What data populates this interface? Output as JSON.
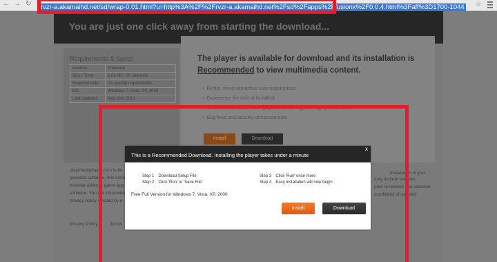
{
  "browser": {
    "back_icon": "back-arrow-icon",
    "forward_icon": "forward-arrow-icon",
    "reload_icon": "reload-icon",
    "url": "rvzr-a.akamaihd.net/sd/wrap-0.01.html?u=http%3A%2F%2Frvzr-a.akamaihd.net%2Fsd%2Fapps%2Ffusionx%2F0.0.4.html%3Faff%3D1700-1044",
    "star_icon": "star-icon",
    "menu_icon": "hamburger-menu-icon"
  },
  "page": {
    "banner": "You are just one click away from starting the download...",
    "requirements_title": "Requirements & Specs",
    "specs": [
      {
        "label": "License:",
        "value": "Freeware"
      },
      {
        "label": "Size / Time:",
        "value": "1.09 Mb / 30 Seconds"
      },
      {
        "label": "Requirements:",
        "value": "No special requirements"
      },
      {
        "label": "OS:",
        "value": "Windows 7, Vista, XP, 2000"
      },
      {
        "label": "Last Updated:",
        "value": "May 2nd, 2013"
      }
    ],
    "headline_part1": "The player is available for download and its installation is",
    "headline_link": "Recommended",
    "headline_part2": " to view multimedia content.",
    "features": [
      "Richer, more immersive user experiences",
      "Experience the web at its fullest",
      "Excellent for video, faster graphics rendering, and high performance",
      "Bug fixes and security enhancements"
    ],
    "install_label": "Install",
    "download_label": "Download",
    "left_text_1": "playmediaplayer.com is de",
    "left_text_2": "selected software, this instal",
    "left_text_3": "browser addons, game app",
    "left_text_4": "software. You are completel",
    "left_text_5": "privacy policy created by p",
    "right_text_1": "installation of you",
    "right_text_2": "may include toolbars,",
    "right_text_3": "prior to receive you selected",
    "right_text_4": "conditions of use and",
    "footer_privacy": "Privacy Policy",
    "footer_terms": "Terms"
  },
  "dialog": {
    "title": "This is a Recommended Download. Installing the player takes under a minute",
    "close": "x",
    "steps": [
      {
        "label": "Step 1",
        "text": "Download Setup File"
      },
      {
        "label": "Step 2",
        "text": "Click 'Run' or 'Save File'"
      },
      {
        "label": "Step 3",
        "text": "Click 'Run' once more"
      },
      {
        "label": "Step 4",
        "text": "Easy installation will now begin"
      }
    ],
    "free_text": "Free Full Version for Windows 7, Vista, XP, 2000",
    "install_label": "Install",
    "download_label": "Download"
  },
  "colors": {
    "highlight_red": "#e81b2a",
    "install_orange": "#f47a2a",
    "dialog_header": "#262626",
    "url_selection": "#3a78d8"
  }
}
